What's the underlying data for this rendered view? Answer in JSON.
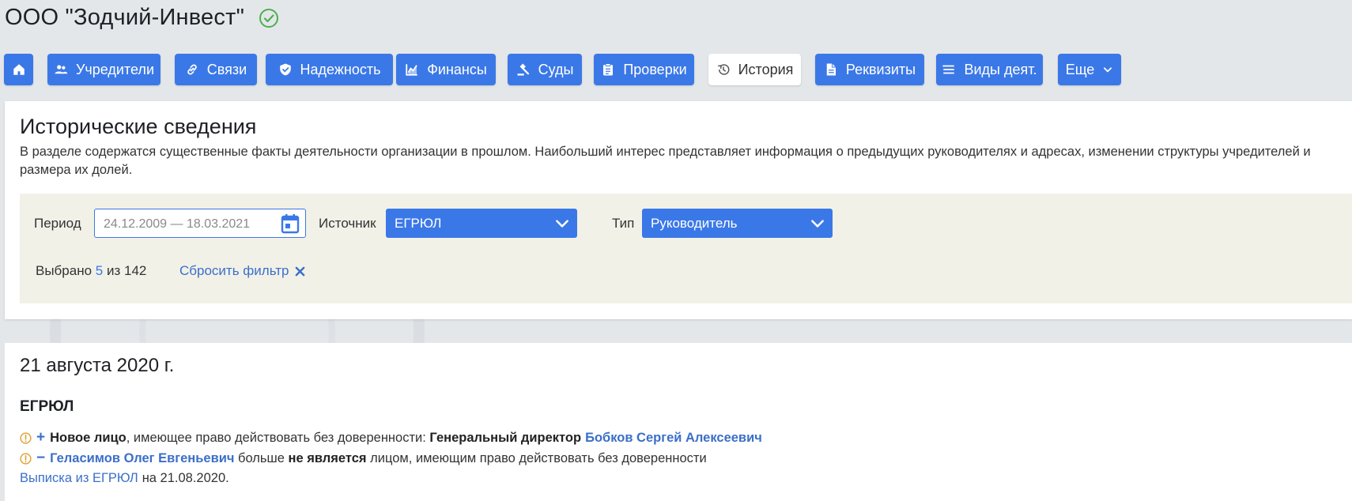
{
  "company": {
    "name": "ООО \"Зодчий-Инвест\"",
    "verified_icon": "check-circle-icon"
  },
  "nav": [
    {
      "key": "home",
      "label": "",
      "icon": "home-icon"
    },
    {
      "key": "founders",
      "label": "Учредители",
      "icon": "people-icon"
    },
    {
      "key": "links",
      "label": "Связи",
      "icon": "link-icon"
    },
    {
      "key": "reliability",
      "label": "Надежность",
      "icon": "shield-check-icon"
    },
    {
      "key": "finance",
      "label": "Финансы",
      "icon": "chart-icon"
    },
    {
      "key": "courts",
      "label": "Суды",
      "icon": "gavel-icon"
    },
    {
      "key": "checks",
      "label": "Проверки",
      "icon": "clipboard-icon"
    },
    {
      "key": "history",
      "label": "История",
      "icon": "history-icon",
      "active": true
    },
    {
      "key": "requisites",
      "label": "Реквизиты",
      "icon": "document-icon"
    },
    {
      "key": "activities",
      "label": "Виды деят.",
      "icon": "list-icon"
    },
    {
      "key": "more",
      "label": "Еще",
      "icon": "chevron-down-icon"
    }
  ],
  "section": {
    "title": "Исторические сведения",
    "description": "В разделе содержатся существенные факты деятельности организации в прошлом. Наибольший интерес представляет информация о предыдущих руководителях и адресах, изменении структуры учредителей и размера их долей."
  },
  "filters": {
    "period_label": "Период",
    "period_value": "24.12.2009 — 18.03.2021",
    "source_label": "Источник",
    "source_value": "ЕГРЮЛ",
    "type_label": "Тип",
    "type_value": "Руководитель",
    "selected_prefix": "Выбрано",
    "selected_count": "5",
    "selected_middle": "из",
    "selected_total": "142",
    "reset_label": "Сбросить фильтр"
  },
  "history": {
    "date": "21 августа 2020 г.",
    "source": "ЕГРЮЛ",
    "entry1": {
      "sign": "+",
      "bold1": "Новое лицо",
      "text1": ", имеющее право действовать без доверенности: ",
      "bold2": "Генеральный директор",
      "person": "Бобков Сергей Алексеевич"
    },
    "entry2": {
      "sign": "−",
      "person": "Геласимов Олег Евгеньевич",
      "text1": " больше ",
      "bold1": "не является",
      "text2": " лицом, имеющим право действовать без доверенности"
    },
    "extract_link": "Выписка из ЕГРЮЛ",
    "extract_suffix": "на 21.08.2020."
  },
  "colors": {
    "accent": "#3b78e7",
    "link": "#3b6fc8",
    "warning": "#e0a33a",
    "success": "#4caf50",
    "filter_bg": "#f1f1e8"
  }
}
